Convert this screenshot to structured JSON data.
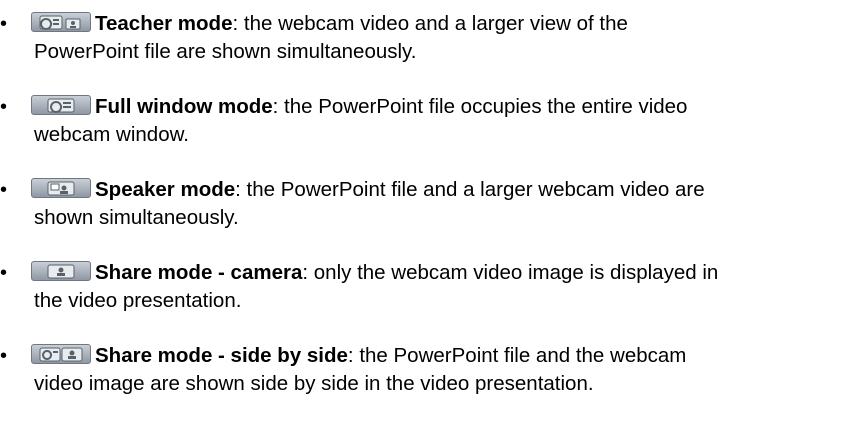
{
  "items": [
    {
      "icon": "teacher-mode-icon",
      "title": "Teacher mode",
      "text1": ": the webcam video and a larger view of the",
      "text2": "PowerPoint file are shown simultaneously."
    },
    {
      "icon": "full-window-mode-icon",
      "title": "Full window mode",
      "text1": ": the PowerPoint file occupies the entire video",
      "text2": "webcam window."
    },
    {
      "icon": "speaker-mode-icon",
      "title": "Speaker mode",
      "text1": ": the PowerPoint file and a larger webcam video are",
      "text2": "shown simultaneously."
    },
    {
      "icon": "share-mode-camera-icon",
      "title": "Share mode - camera",
      "text1": ": only the webcam video image is displayed in",
      "text2": "the video presentation."
    },
    {
      "icon": "share-mode-side-by-side-icon",
      "title": "Share mode - side by side",
      "text1": ": the PowerPoint file and the webcam",
      "text2": "video image are shown side by side in the video presentation."
    }
  ]
}
